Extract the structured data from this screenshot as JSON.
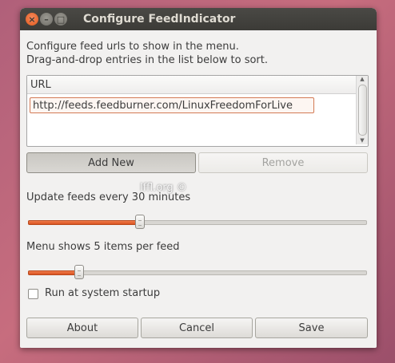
{
  "window": {
    "title": "Configure FeedIndicator",
    "close_glyph": "×",
    "minimize_glyph": "–",
    "maximize_glyph": "□"
  },
  "description": {
    "line1": "Configure feed urls to show in the menu.",
    "line2": "Drag-and-drop entries in the list below to sort."
  },
  "feed_list": {
    "column_header": "URL",
    "entries": [
      "http://feeds.feedburner.com/LinuxFreedomForLive"
    ]
  },
  "list_buttons": {
    "add_label": "Add New",
    "remove_label": "Remove"
  },
  "watermark": "lffl.org ©",
  "update_slider": {
    "label": "Update feeds every 30 minutes",
    "fraction": 0.33
  },
  "items_slider": {
    "label": "Menu shows 5 items per feed",
    "fraction": 0.15
  },
  "startup": {
    "label": "Run at system startup",
    "checked": false
  },
  "footer": {
    "about_label": "About",
    "cancel_label": "Cancel",
    "save_label": "Save"
  },
  "colors": {
    "accent": "#dd5a23",
    "titlebar": "#3c3b37"
  }
}
